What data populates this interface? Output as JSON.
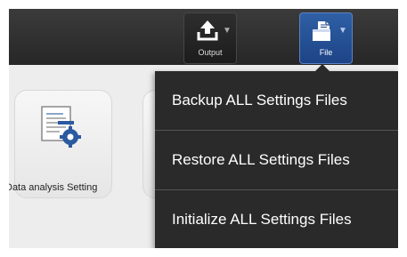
{
  "toolbar": {
    "buttons": [
      {
        "label": "Output",
        "icon": "upload-icon"
      },
      {
        "label": "File",
        "icon": "file-icon",
        "active": true,
        "accent": "#2a56a0"
      }
    ]
  },
  "main": {
    "tiles": [
      {
        "label": "Data analysis Setting",
        "icon": "data-analysis-gear-icon"
      }
    ]
  },
  "file_menu": {
    "items": [
      {
        "label": "Backup ALL Settings Files"
      },
      {
        "label": "Restore ALL Settings Files"
      },
      {
        "label": "Initialize ALL Settings Files"
      }
    ]
  }
}
